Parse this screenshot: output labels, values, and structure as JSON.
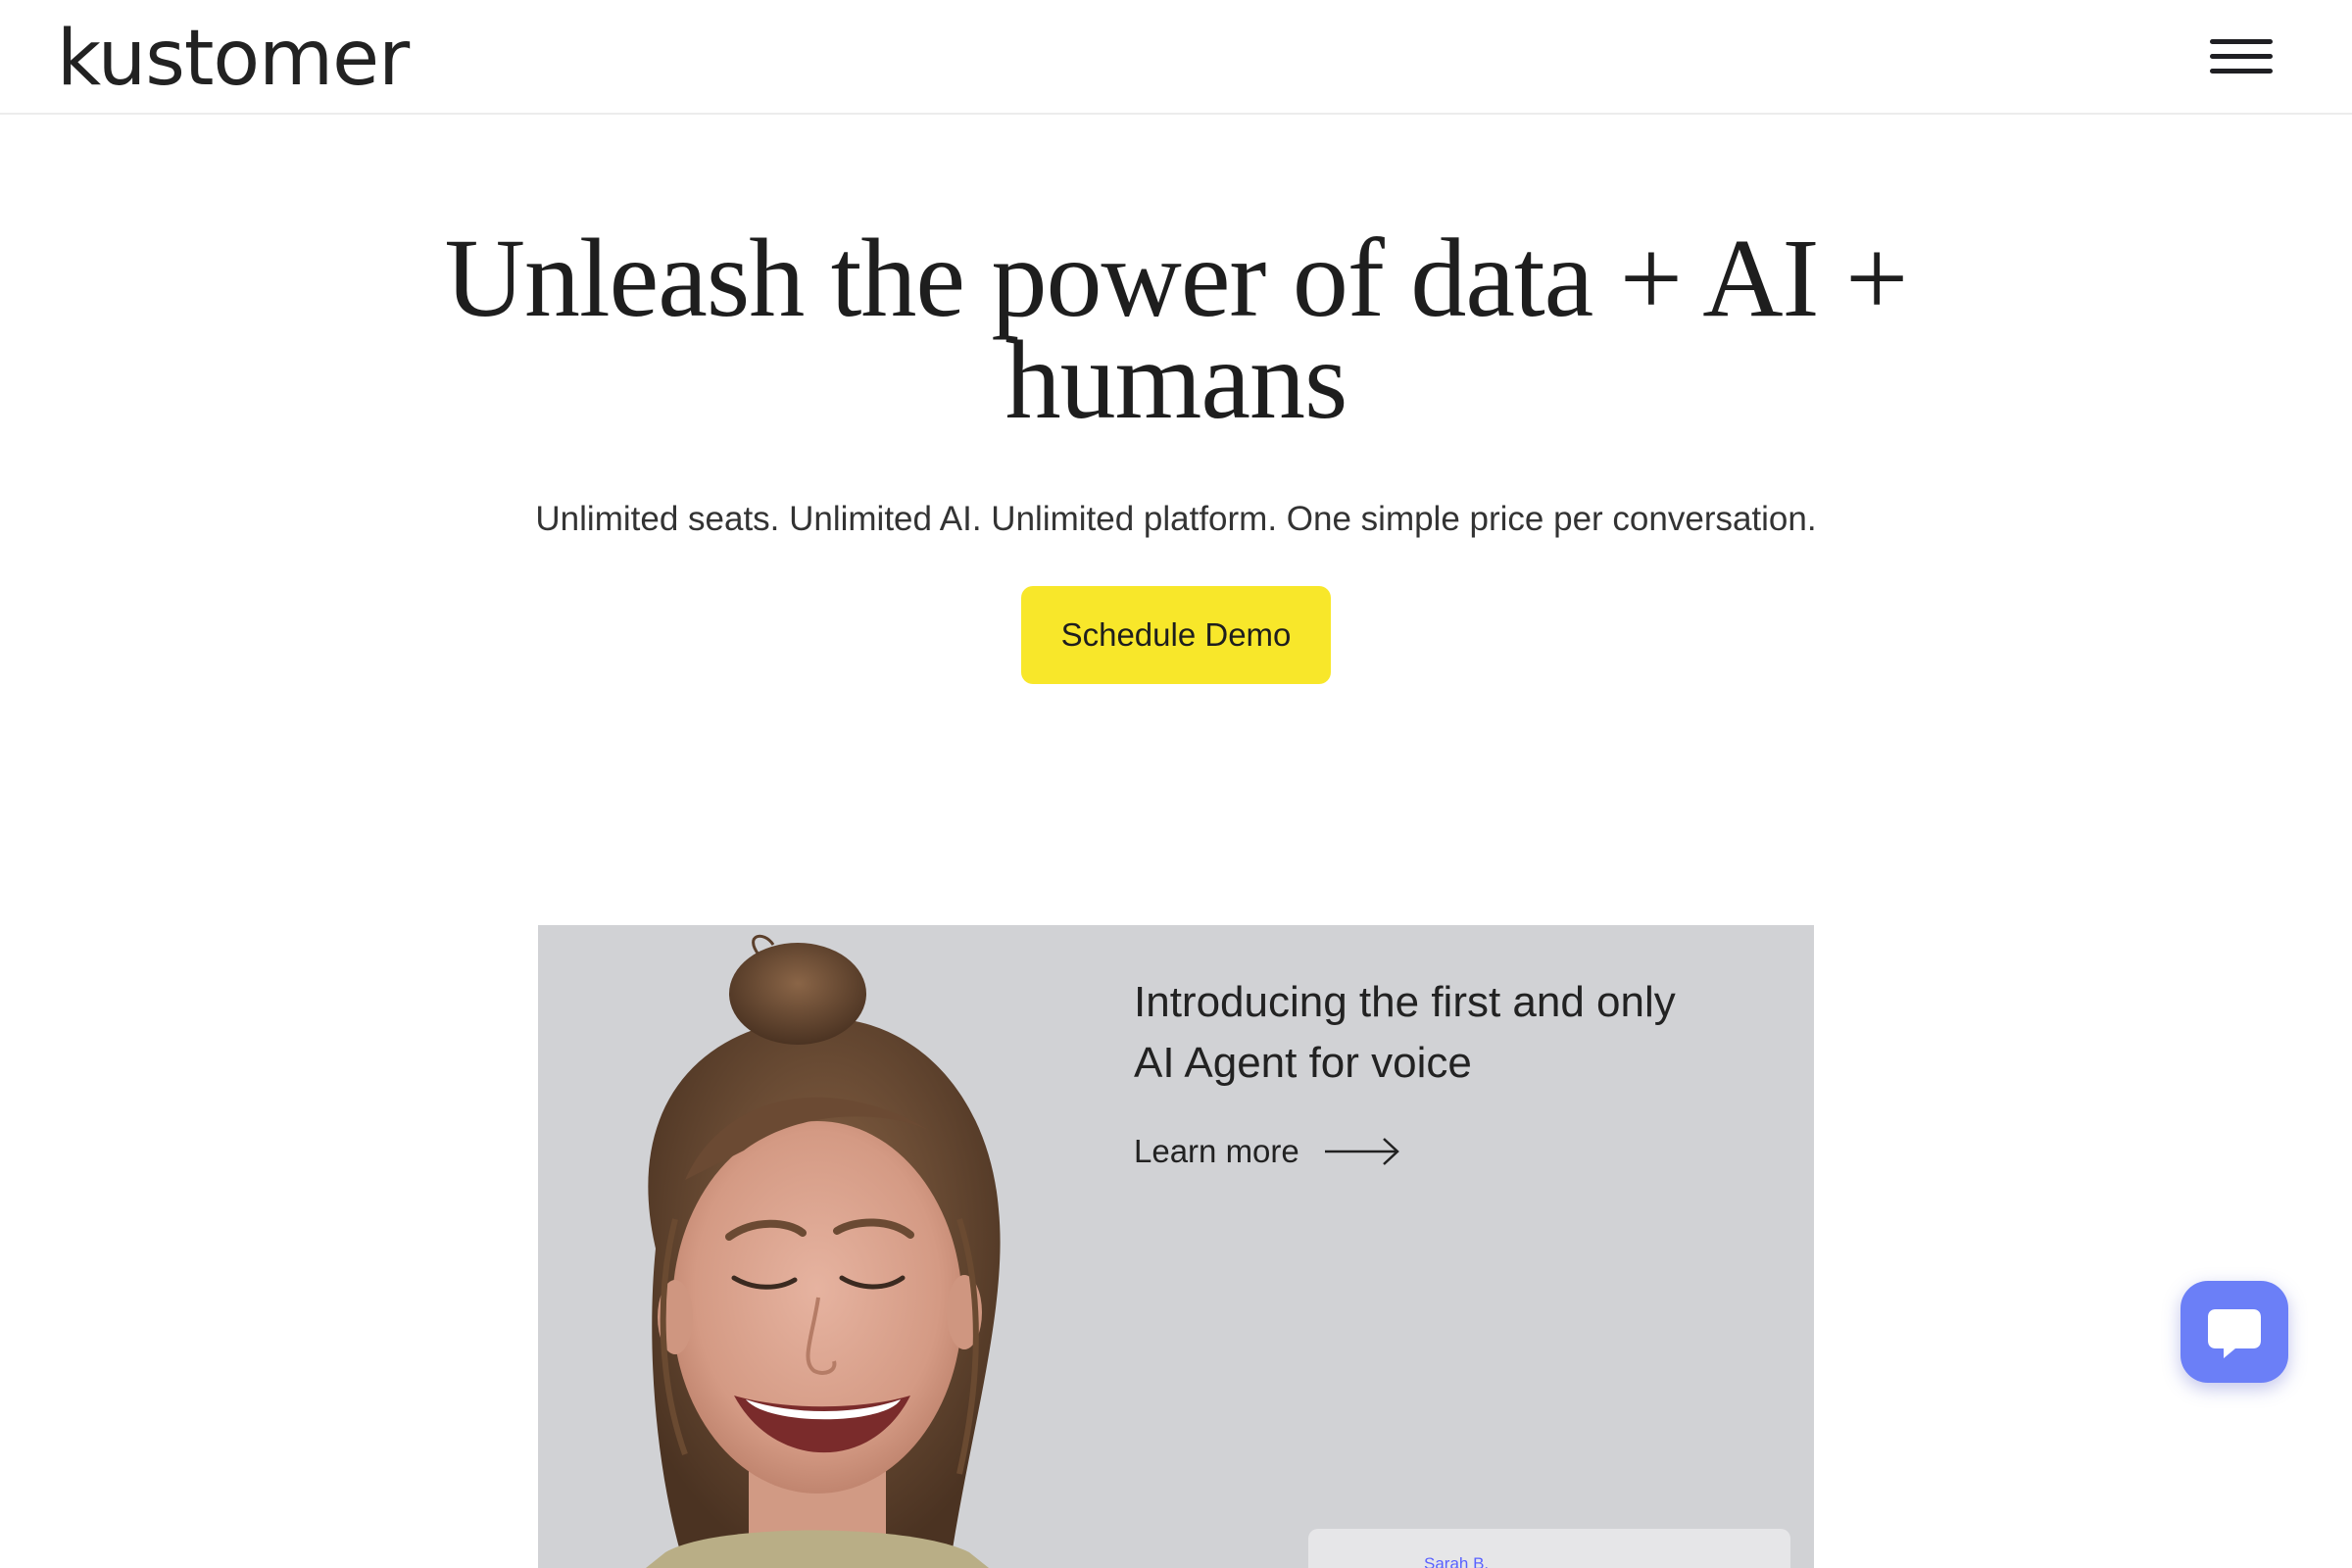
{
  "header": {
    "logo_text": "kustomer",
    "menu_icon": "hamburger-menu-icon"
  },
  "hero": {
    "title_line1": "Unleash the power of data + AI +",
    "title_line2": "humans",
    "subtitle": "Unlimited seats. Unlimited AI. Unlimited platform. One simple price per conversation.",
    "cta_label": "Schedule Demo"
  },
  "banner": {
    "title_line1": "Introducing the first and only",
    "title_line2": "AI Agent for voice",
    "learn_more_label": "Learn more",
    "arrow_icon": "arrow-right-icon",
    "preview_name": "Sarah B."
  },
  "chat": {
    "icon": "chat-bubble-icon"
  },
  "colors": {
    "cta_background": "#f8e72a",
    "chat_button": "#6b7ff7",
    "banner_background": "#d1d2d5",
    "preview_name": "#5a62ff"
  }
}
